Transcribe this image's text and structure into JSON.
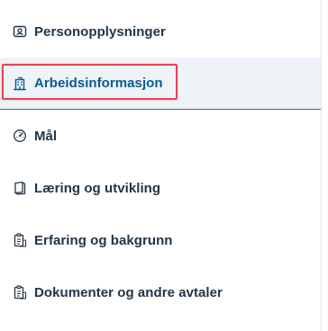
{
  "nav": {
    "items": [
      {
        "label": "Personopplysninger",
        "icon": "person-card-icon",
        "selected": false
      },
      {
        "label": "Arbeidsinformasjon",
        "icon": "building-icon",
        "selected": true
      },
      {
        "label": "Mål",
        "icon": "target-gauge-icon",
        "selected": false
      },
      {
        "label": "Læring og utvikling",
        "icon": "book-icon",
        "selected": false
      },
      {
        "label": "Erfaring og bakgrunn",
        "icon": "clipboard-icon",
        "selected": false
      },
      {
        "label": "Dokumenter og andre avtaler",
        "icon": "clipboard-icon",
        "selected": false
      }
    ]
  },
  "colors": {
    "text": "#223548",
    "selected_text": "#0a5b8f",
    "selected_bg": "#eef3f8",
    "selected_border": "#2b6c9a",
    "highlight": "#e04556"
  }
}
